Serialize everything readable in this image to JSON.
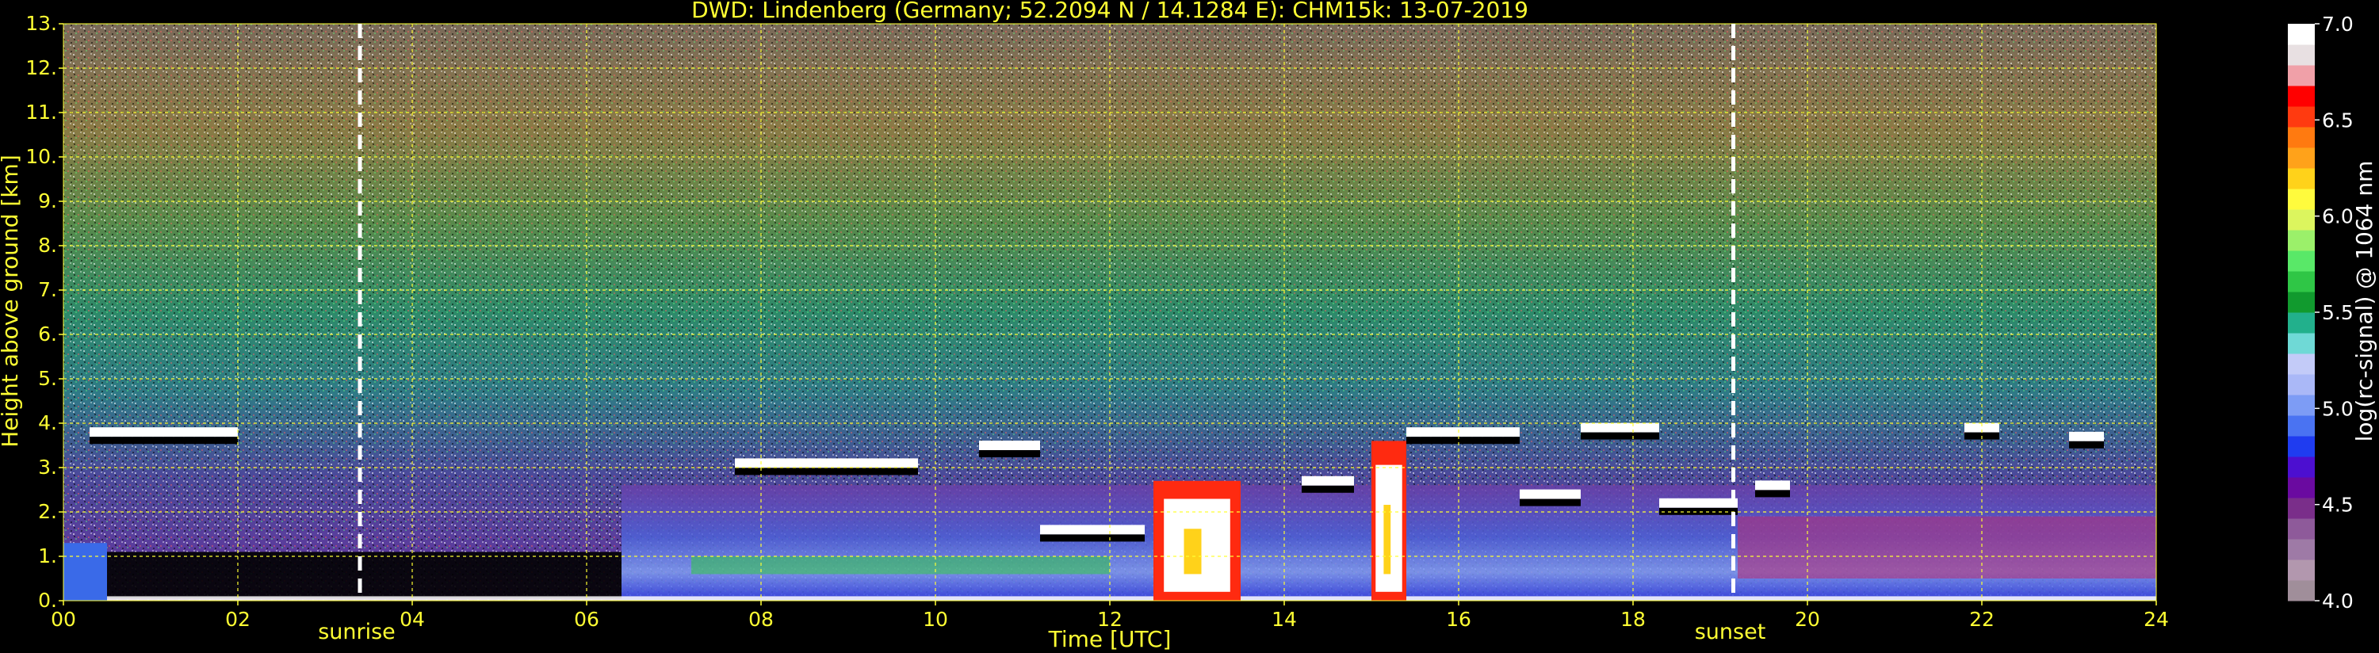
{
  "chart_data": {
    "type": "heatmap",
    "title": "DWD: Lindenberg (Germany; 52.2094 N / 14.1284 E):    CHM15k: 13-07-2019",
    "xlabel": "Time [UTC]",
    "ylabel": "Height above ground [km]",
    "xlim": [
      0,
      24
    ],
    "ylim": [
      0,
      13
    ],
    "x_ticks": [
      "00",
      "02",
      "04",
      "06",
      "08",
      "10",
      "12",
      "14",
      "16",
      "18",
      "20",
      "22",
      "24"
    ],
    "y_ticks": [
      "0.",
      "1.",
      "2.",
      "3.",
      "4.",
      "5.",
      "6.",
      "7.",
      "8.",
      "9.",
      "10.",
      "11.",
      "12.",
      "13."
    ],
    "grid": true,
    "grid_color": "#ffff33",
    "annotations": [
      {
        "label": "sunrise",
        "x": 3.4
      },
      {
        "label": "sunset",
        "x": 19.15
      }
    ],
    "colorbar": {
      "label": "log(rc-signal) @ 1064 nm",
      "range": [
        4.0,
        7.0
      ],
      "ticks": [
        "4.0",
        "4.5",
        "5.0",
        "5.5",
        "6.0",
        "6.5",
        "7.0"
      ],
      "colors": [
        "#a08e9a",
        "#b297ae",
        "#9e7aa6",
        "#8e5a9a",
        "#7a2e8a",
        "#6a0aa0",
        "#4c0fd0",
        "#1f3cf0",
        "#4a73f2",
        "#7d9cf5",
        "#aab8f7",
        "#c3cbf8",
        "#6fd9d6",
        "#22b08c",
        "#119a2e",
        "#2fc646",
        "#59e868",
        "#9bf06a",
        "#dcf55e",
        "#fffb3d",
        "#ffd21a",
        "#ffa21a",
        "#ff7a10",
        "#ff3a10",
        "#ff0000",
        "#f0a0a8",
        "#e8e0e2",
        "#ffffff"
      ]
    },
    "cloud_layers": [
      {
        "t0": 0.3,
        "t1": 2.0,
        "h": 3.8
      },
      {
        "t0": 7.7,
        "t1": 9.8,
        "h": 3.1
      },
      {
        "t0": 10.5,
        "t1": 11.2,
        "h": 3.5
      },
      {
        "t0": 11.2,
        "t1": 12.4,
        "h": 1.6
      },
      {
        "t0": 14.2,
        "t1": 14.8,
        "h": 2.7
      },
      {
        "t0": 15.4,
        "t1": 16.7,
        "h": 3.8
      },
      {
        "t0": 16.7,
        "t1": 17.4,
        "h": 2.4
      },
      {
        "t0": 17.4,
        "t1": 18.3,
        "h": 3.9
      },
      {
        "t0": 18.3,
        "t1": 19.2,
        "h": 2.2
      },
      {
        "t0": 19.4,
        "t1": 19.8,
        "h": 2.6
      },
      {
        "t0": 21.8,
        "t1": 22.2,
        "h": 3.9
      },
      {
        "t0": 23.0,
        "t1": 23.4,
        "h": 3.7
      }
    ],
    "convective_cells": [
      {
        "t0": 12.5,
        "t1": 13.5,
        "h": 2.7
      },
      {
        "t0": 15.0,
        "t1": 15.4,
        "h": 3.6
      }
    ]
  }
}
